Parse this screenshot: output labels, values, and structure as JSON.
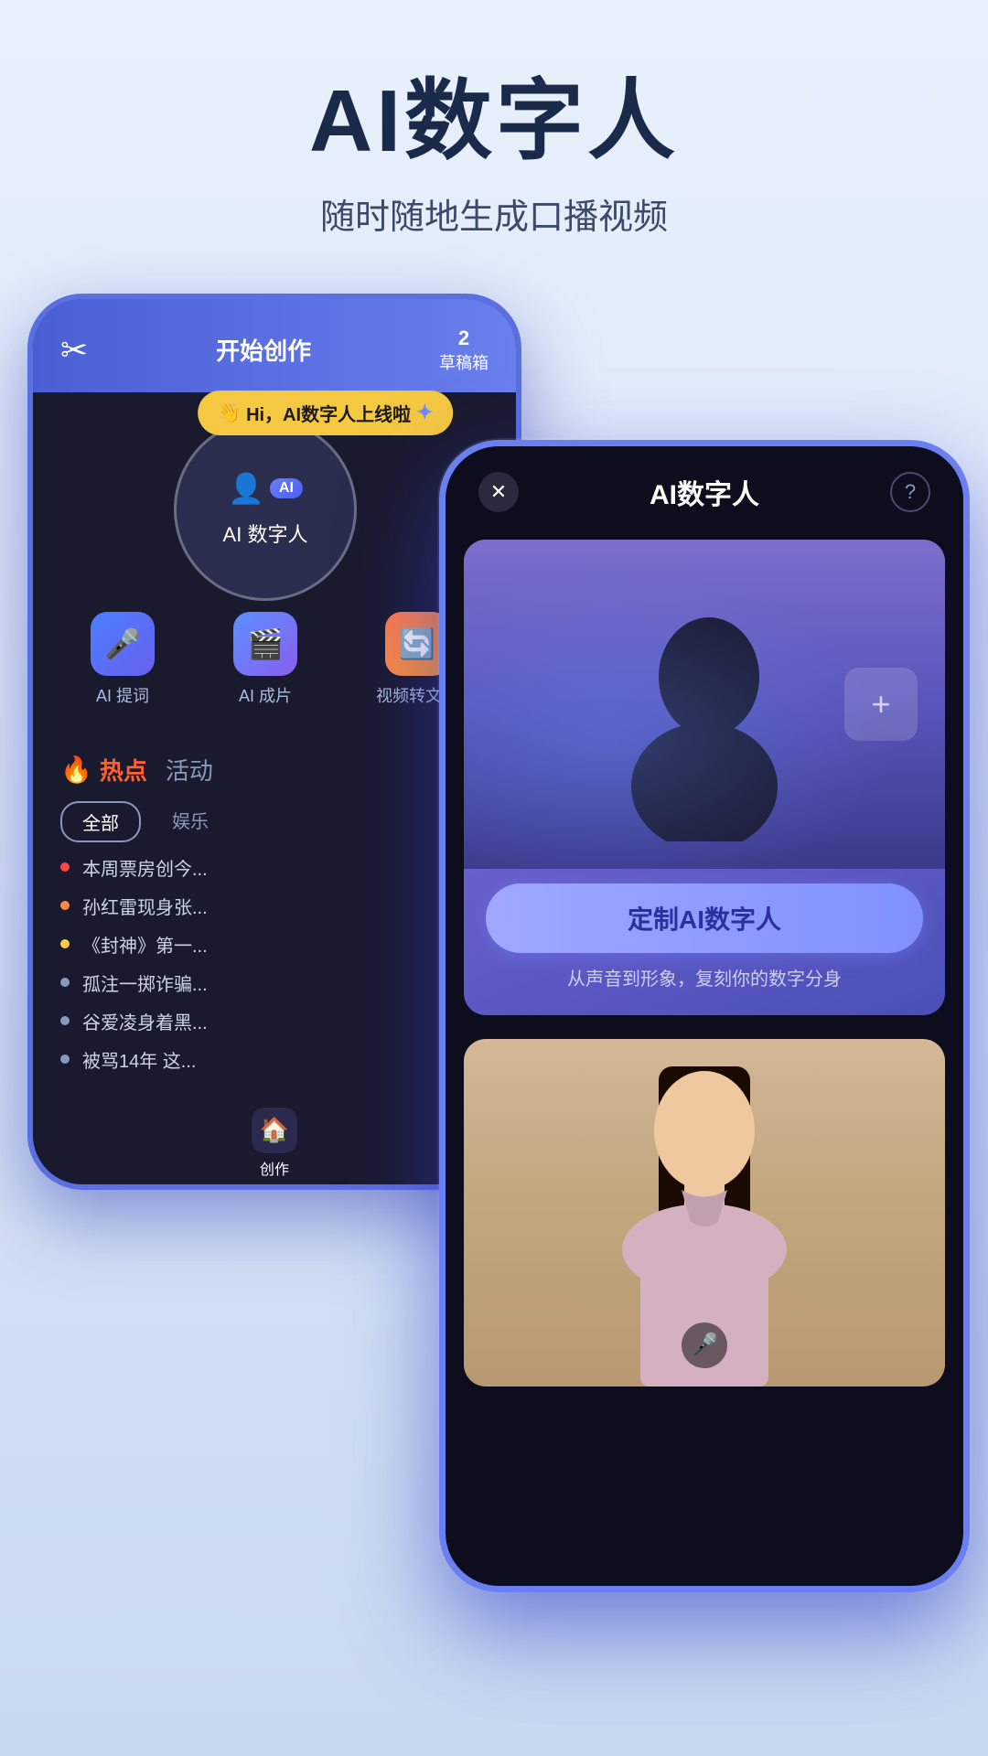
{
  "hero": {
    "title": "AI数字人",
    "subtitle": "随时随地生成口播视频"
  },
  "back_phone": {
    "header": {
      "scissors_label": "✂",
      "start_create": "开始创作",
      "draft_count": "2",
      "draft_label": "草稿箱"
    },
    "notification": {
      "emoji": "👋",
      "text": "Hi，AI数字人上线啦"
    },
    "circle_menu": {
      "label": "AI 数字人"
    },
    "features": [
      {
        "label": "AI 提词",
        "color": "blue",
        "icon": "🎤"
      },
      {
        "label": "AI 成片",
        "color": "teal",
        "icon": "🎬"
      },
      {
        "label": "视频转文字",
        "color": "orange",
        "icon": "🔄"
      }
    ],
    "hot_section": {
      "tab_hot": "热点",
      "tab_activity": "活动",
      "filter_all": "全部",
      "filter_entertainment": "娱乐",
      "news": [
        {
          "text": "本周票房创今...",
          "dot": "red"
        },
        {
          "text": "孙红雷现身张...",
          "dot": "orange"
        },
        {
          "text": "《封神》第一...",
          "dot": "yellow"
        },
        {
          "text": "孤注一掷诈骗...",
          "dot": "gray"
        },
        {
          "text": "谷爱凌身着黑...",
          "dot": "gray"
        },
        {
          "text": "被骂14年 这...",
          "dot": "gray"
        }
      ]
    },
    "bottom_nav": {
      "icon": "🏠",
      "label": "创作"
    }
  },
  "front_phone": {
    "header": {
      "close": "✕",
      "help": "?",
      "title": "AI数字人"
    },
    "digital_card": {
      "customize_btn": "定制AI数字人",
      "description": "从声音到形象，复刻你的数字分身"
    }
  }
}
